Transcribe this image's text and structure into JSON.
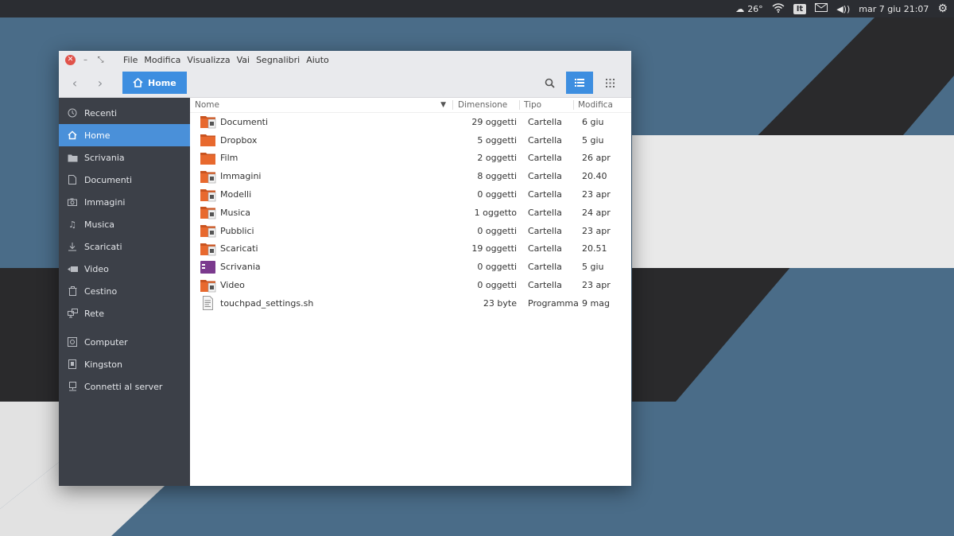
{
  "panel": {
    "weather_temp": "26°",
    "keyboard_layout": "It",
    "clock": "mar  7 giu 21:07"
  },
  "window": {
    "menus": [
      "File",
      "Modifica",
      "Visualizza",
      "Vai",
      "Segnalibri",
      "Aiuto"
    ],
    "path_label": "Home"
  },
  "sidebar": {
    "items": [
      {
        "label": "Recenti",
        "icon": "clock-icon"
      },
      {
        "label": "Home",
        "icon": "home-icon",
        "active": true
      },
      {
        "label": "Scrivania",
        "icon": "desktop-folder-icon"
      },
      {
        "label": "Documenti",
        "icon": "document-icon"
      },
      {
        "label": "Immagini",
        "icon": "camera-icon"
      },
      {
        "label": "Musica",
        "icon": "music-icon"
      },
      {
        "label": "Scaricati",
        "icon": "download-icon"
      },
      {
        "label": "Video",
        "icon": "video-icon"
      },
      {
        "label": "Cestino",
        "icon": "trash-icon"
      },
      {
        "label": "Rete",
        "icon": "network-icon"
      }
    ],
    "devices": [
      {
        "label": "Computer",
        "icon": "computer-icon"
      },
      {
        "label": "Kingston",
        "icon": "usb-drive-icon"
      },
      {
        "label": "Connetti al server",
        "icon": "server-icon"
      }
    ]
  },
  "columns": {
    "name": "Nome",
    "size": "Dimensione",
    "type": "Tipo",
    "modified": "Modifica"
  },
  "files": [
    {
      "name": "Documenti",
      "size": "29 oggetti",
      "type": "Cartella",
      "modified": "6 giu",
      "icon": "folder-documents-icon"
    },
    {
      "name": "Dropbox",
      "size": "5 oggetti",
      "type": "Cartella",
      "modified": "5 giu",
      "icon": "folder-icon"
    },
    {
      "name": "Film",
      "size": "2 oggetti",
      "type": "Cartella",
      "modified": "26 apr",
      "icon": "folder-icon"
    },
    {
      "name": "Immagini",
      "size": "8 oggetti",
      "type": "Cartella",
      "modified": "20.40",
      "icon": "folder-pictures-icon"
    },
    {
      "name": "Modelli",
      "size": "0 oggetti",
      "type": "Cartella",
      "modified": "23 apr",
      "icon": "folder-templates-icon"
    },
    {
      "name": "Musica",
      "size": "1 oggetto",
      "type": "Cartella",
      "modified": "24 apr",
      "icon": "folder-music-icon"
    },
    {
      "name": "Pubblici",
      "size": "0 oggetti",
      "type": "Cartella",
      "modified": "23 apr",
      "icon": "folder-public-icon"
    },
    {
      "name": "Scaricati",
      "size": "19 oggetti",
      "type": "Cartella",
      "modified": "20.51",
      "icon": "folder-download-icon"
    },
    {
      "name": "Scrivania",
      "size": "0 oggetti",
      "type": "Cartella",
      "modified": "5 giu",
      "icon": "folder-desktop-icon"
    },
    {
      "name": "Video",
      "size": "0 oggetti",
      "type": "Cartella",
      "modified": "23 apr",
      "icon": "folder-videos-icon"
    },
    {
      "name": "touchpad_settings.sh",
      "size": "23 byte",
      "type": "Programma",
      "modified": "9 mag",
      "icon": "script-file-icon"
    }
  ],
  "colors": {
    "accent": "#3d8ee0",
    "sidebar_bg": "#3c4048",
    "panel_bg": "#2b2d32",
    "folder_orange": "#e8692e"
  }
}
